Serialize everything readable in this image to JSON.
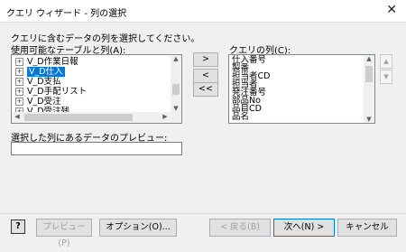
{
  "window": {
    "title": "クエリ ウィザード - 列の選択",
    "close_glyph": "✕"
  },
  "instruction": "クエリに含むデータの列を選択してください。",
  "available_label": "使用可能なテーブルと列(A):",
  "available_items": [
    {
      "label": "V_D作業日報",
      "selected": false
    },
    {
      "label": "V_D仕入",
      "selected": true
    },
    {
      "label": "V_D支払",
      "selected": false
    },
    {
      "label": "V_D手配リスト",
      "selected": false
    },
    {
      "label": "V_D受注",
      "selected": false
    },
    {
      "label": "V_D受注残",
      "selected": false
    }
  ],
  "query_label": "クエリの列(C):",
  "query_columns": [
    "仕入番号",
    "製番",
    "担当者CD",
    "担当者",
    "発注番号",
    "部品No",
    "品目CD",
    "品名"
  ],
  "move_buttons": {
    "add": ">",
    "remove": "<",
    "remove_all": "<<"
  },
  "order_buttons": {
    "up": "▲",
    "down": "▼"
  },
  "preview_label": "選択した列にあるデータのプレビュー:",
  "preview_value": "",
  "footer": {
    "help": "?",
    "preview": "プレビュー(P)",
    "options": "オプション(O)...",
    "back": "< 戻る(B)",
    "next": "次へ(N) >",
    "cancel": "キャンセル"
  }
}
